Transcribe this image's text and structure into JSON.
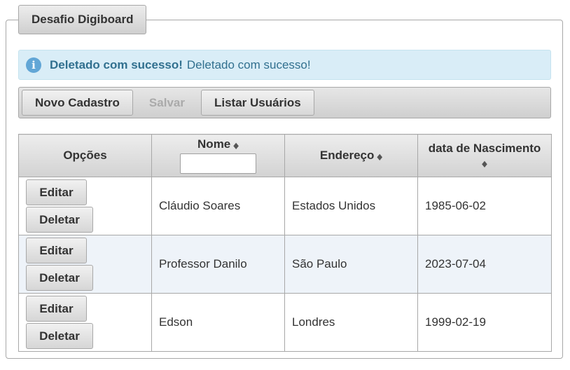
{
  "panel": {
    "legend": "Desafio Digiboard"
  },
  "message": {
    "icon": "info-icon",
    "icon_glyph": "i",
    "summary": "Deletado com sucesso!",
    "detail": "Deletado com sucesso!",
    "background": "#d9edf7",
    "text_color": "#31708f"
  },
  "toolbar": {
    "new_label": "Novo Cadastro",
    "save_label": "Salvar",
    "list_label": "Listar Usuários"
  },
  "table": {
    "columns": {
      "options": "Opções",
      "name": "Nome",
      "address": "Endereço",
      "birthdate": "data de Nascimento"
    },
    "sort_glyph": "◆",
    "name_filter_value": "",
    "edit_label": "Editar",
    "delete_label": "Deletar",
    "rows": [
      {
        "name": "Cláudio Soares",
        "address": "Estados Unidos",
        "birthdate": "1985-06-02"
      },
      {
        "name": "Professor Danilo",
        "address": "São Paulo",
        "birthdate": "2023-07-04"
      },
      {
        "name": "Edson",
        "address": "Londres",
        "birthdate": "1999-02-19"
      }
    ]
  }
}
